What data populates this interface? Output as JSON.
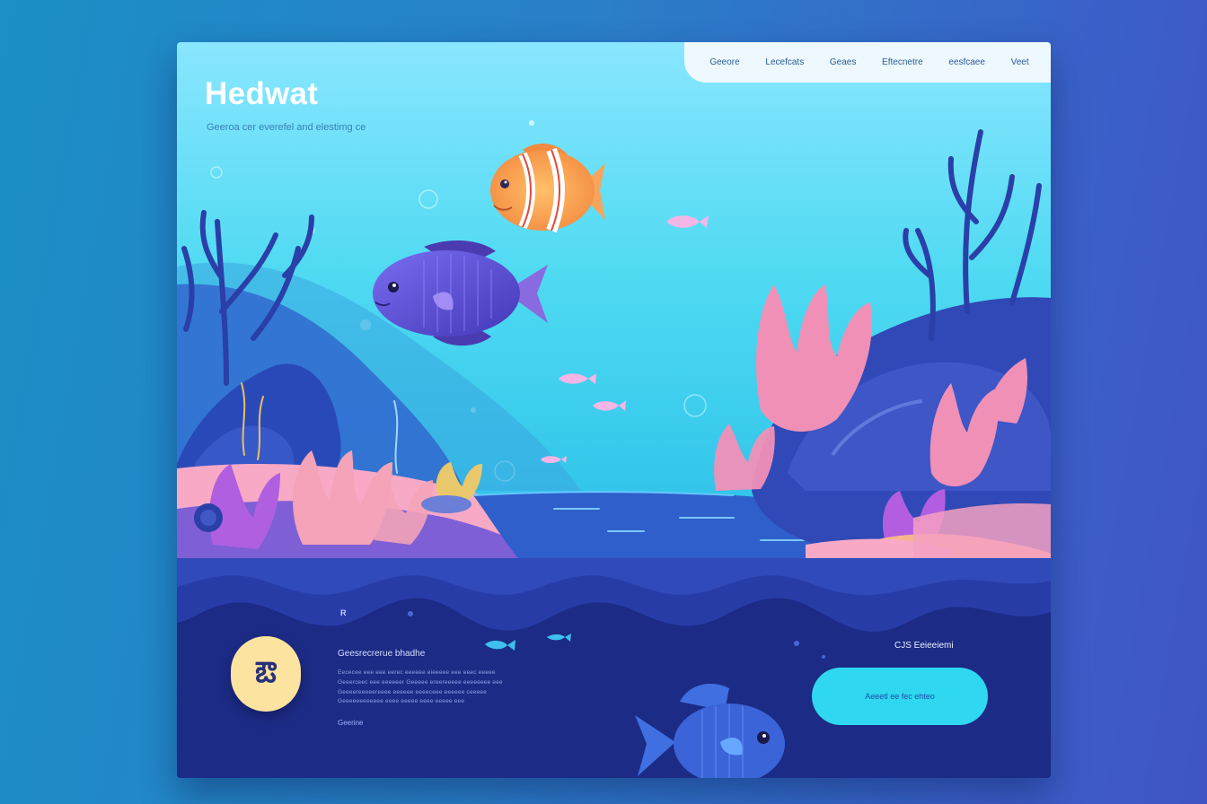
{
  "nav": {
    "items": [
      "Geeore",
      "Lecefcats",
      "Geaes",
      "Eftecnetre",
      "eesfcaee",
      "Veet"
    ]
  },
  "hero": {
    "brand": "Hedwat",
    "tagline": "Geeroa cer everefel and elestimg ce"
  },
  "feature": {
    "small_mark": "R",
    "logo_glyph": "ఔ",
    "title": "Geesrecrerue bhadhe",
    "lines": [
      "Eececee eee eee eerec eeeeee eieeeee eee eeec eeeee",
      "Geeerceec eee eeeeeer Geeeee ereereeeee eeeeeeee eee",
      "Geeeereeeeereeee eeeeee eeeeceee eeeeee ceeeee",
      "Geeeeeeeeeeee eeee eeeee eeee eeeee eee"
    ],
    "link": "Geerine"
  },
  "cta": {
    "label": "CJS Eeieeiemi",
    "button": "Aeeetl ee fec ehteo"
  },
  "colors": {
    "accent": "#2fd8f0",
    "deep": "#1c2e8a",
    "badge": "#fde3a0",
    "coral": "#f08bb4"
  }
}
